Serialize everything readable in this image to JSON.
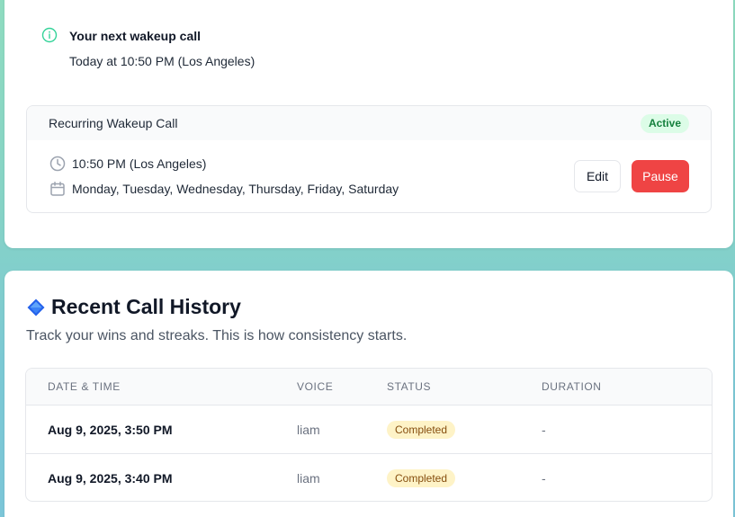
{
  "next_call": {
    "title": "Your next wakeup call",
    "time": "Today at 10:50 PM (Los Angeles)"
  },
  "recurring": {
    "title": "Recurring Wakeup Call",
    "status": "Active",
    "time": "10:50 PM (Los Angeles)",
    "days": "Monday, Tuesday, Wednesday, Thursday, Friday, Saturday",
    "edit_label": "Edit",
    "pause_label": "Pause"
  },
  "history": {
    "title": "Recent Call History",
    "subtitle": "Track your wins and streaks. This is how consistency starts.",
    "columns": [
      "Date & Time",
      "Voice",
      "Status",
      "Duration"
    ],
    "rows": [
      {
        "date": "Aug 9, 2025, 3:50 PM",
        "voice": "liam",
        "status": "Completed",
        "duration": "-"
      },
      {
        "date": "Aug 9, 2025, 3:40 PM",
        "voice": "liam",
        "status": "Completed",
        "duration": "-"
      }
    ]
  },
  "colors": {
    "accent_green": "#15803d",
    "pause_red": "#ef4444",
    "status_yellow": "#fef3c7"
  }
}
